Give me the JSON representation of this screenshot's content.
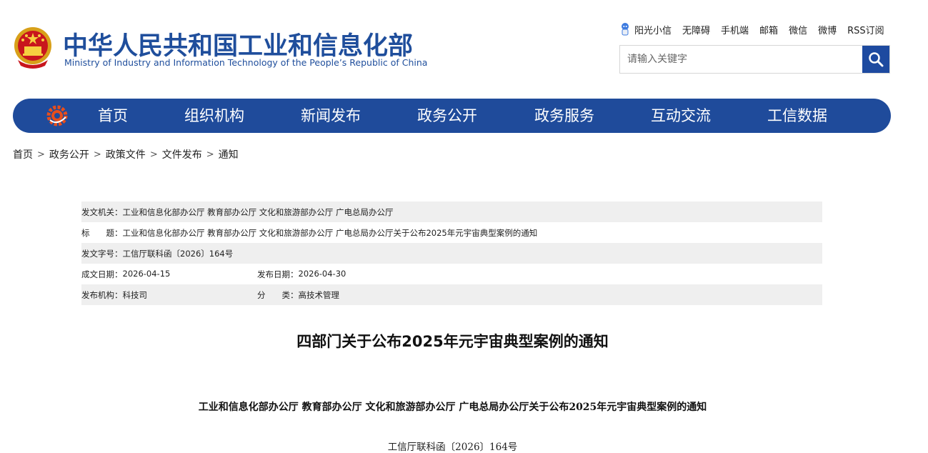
{
  "header": {
    "title_cn": "中华人民共和国工业和信息化部",
    "title_en": "Ministry of Industry and Information Technology of the People’s Republic of China",
    "links": [
      "阳光小信",
      "无障碍",
      "手机端",
      "邮箱",
      "微信",
      "微博",
      "RSS订阅"
    ],
    "search_placeholder": "请输入关键字"
  },
  "nav": {
    "items": [
      "首页",
      "组织机构",
      "新闻发布",
      "政务公开",
      "政务服务",
      "互动交流",
      "工信数据"
    ]
  },
  "breadcrumb": [
    "首页",
    "政务公开",
    "政策文件",
    "文件发布",
    "通知"
  ],
  "info": {
    "issuer_label": "发文机关：",
    "issuer": "工业和信息化部办公厅 教育部办公厅 文化和旅游部办公厅 广电总局办公厅",
    "title_label": "标　　题：",
    "title": "工业和信息化部办公厅 教育部办公厅 文化和旅游部办公厅 广电总局办公厅关于公布2025年元宇宙典型案例的通知",
    "docno_label": "发文字号：",
    "docno": "工信厅联科函〔2026〕164号",
    "created_label": "成文日期：",
    "created": "2026-04-15",
    "published_label": "发布日期：",
    "published": "2026-04-30",
    "org_label": "发布机构：",
    "org": "科技司",
    "category_label": "分　　类：",
    "category": "高技术管理"
  },
  "article": {
    "headline": "四部门关于公布2025年元宇宙典型案例的通知",
    "subhead": "工业和信息化部办公厅  教育部办公厅  文化和旅游部办公厅  广电总局办公厅关于公布2025年元宇宙典型案例的通知",
    "docno": "工信厅联科函〔2026〕164号"
  },
  "colors": {
    "brand_blue": "#1f4b9b",
    "info_grey": "#efefef"
  }
}
